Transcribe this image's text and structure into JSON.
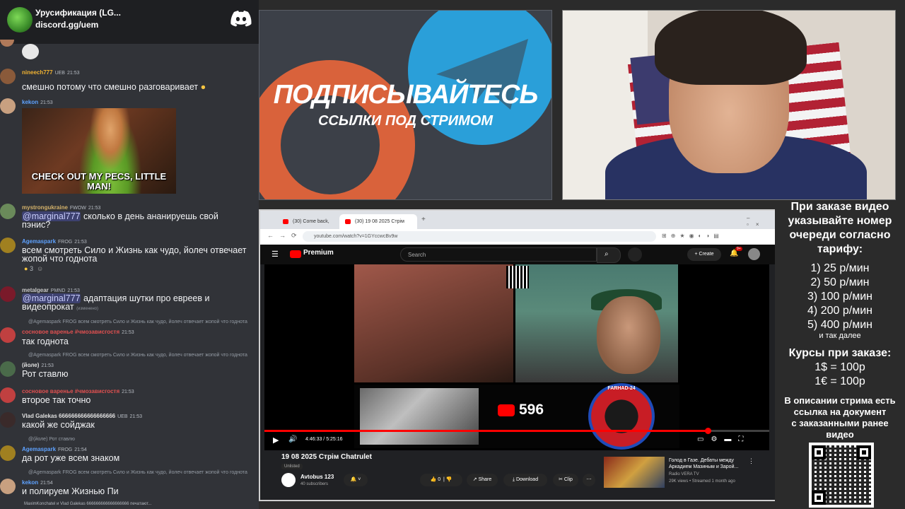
{
  "chat_header": {
    "server_name": "Урусификация (LG...",
    "invite": "discord.gg/uem"
  },
  "messages": [
    {
      "user": "nineech777",
      "badges": "UEB",
      "time": "21:53",
      "text": "смешно потому что смешно разговаривает",
      "user_color": "#f0b232"
    },
    {
      "user": "kekon",
      "time": "21:53",
      "gif_caption": "CHECK OUT MY PECS, LITTLE MAN!",
      "user_color": "#5ea2ff"
    },
    {
      "user": "mystrongukraine",
      "badges": "FWOW",
      "time": "21:53",
      "mention": "@marginal777",
      "text_a": " сколько в день ананируешь свой",
      "text_b": "пэнис?",
      "user_color": "#d4b26a"
    },
    {
      "user": "Agemaspark",
      "badges": "FROG",
      "time": "21:53",
      "text_a": "всем смотреть Сило и Жизнь как чудо, йолеч отвечает",
      "text_b": "жопой что годнота",
      "reaction": "3",
      "user_color": "#5ea2ff"
    },
    {
      "user": "metalgear",
      "badges": "PMND",
      "time": "21:53",
      "mention": "@marginal777",
      "text_a": " адаптация шутки про евреев и",
      "text_b": "видеопрокат",
      "edited": "(изменено)",
      "user_color": "#c8c8c8"
    },
    {
      "reply": "@Agemaspark FROG всем смотреть Сило и Жизнь как чудо, йолеч отвечает жопой что годнота",
      "user": "сосновое варенье #чмозависгостя",
      "time": "21:53",
      "text": "так годнота",
      "user_color": "#e05050"
    },
    {
      "reply": "@Agemaspark FROG всем смотреть Сило и Жизнь как чудо, йолеч отвечает жопой что годнота",
      "user": "(йоле)",
      "time": "21:53",
      "text": "Рот ставлю",
      "user_color": "#e0e0e0"
    },
    {
      "user": "сосновое варенье #чмозависгостя",
      "time": "21:53",
      "text": "второе так точно",
      "user_color": "#e05050"
    },
    {
      "user": "Vlad Galekas 666666666666666666",
      "badges": "UEB",
      "time": "21:53",
      "text": "какой же сойджак",
      "user_color": "#e0e0e0"
    },
    {
      "reply": "@(йоле) Рот ставлю",
      "user": "Agemaspark",
      "badges": "FROG",
      "time": "21:54",
      "text": "да рот уже всем знаком",
      "user_color": "#5ea2ff"
    },
    {
      "reply": "@Agemaspark FROG всем смотреть Сило и Жизнь как чудо, йолеч отвечает жопой что годнота",
      "user": "kekon",
      "time": "21:54",
      "text": "и полируем Жизнью Пи",
      "user_color": "#5ea2ff"
    }
  ],
  "typing": "MaximKonchatel и Vlad Galekas 666666666666666666 печатают...",
  "promo": {
    "title": "ПОДПИСЫВАЙТЕСЬ",
    "subtitle": "ССЫЛКИ ПОД СТРИМОМ"
  },
  "browser": {
    "tab1": "(30) Come back, kam...",
    "tab2": "(30) 19 08 2025 Стрім Chat...",
    "url": "youtube.com/watch?v=1GYccwcBv9w",
    "yt_logo": "Premium",
    "search_placeholder": "Search",
    "create": "+ Create",
    "notif_count": "9+",
    "video_overlay_count": "596",
    "badge_text": "FARHAD-24",
    "time": "4:46:33 / 5:25:16",
    "video_title": "19 08 2025 Стрім Chatrulet",
    "unlisted": "Unlisted",
    "channel": "Avtobus 123",
    "subscribers": "40 subscribers",
    "likes": "0",
    "share": "Share",
    "download": "Download",
    "clip": "Clip",
    "rec_title": "Голод в Газе. Дебаты между Аркадием Мазиным и Зарой...",
    "rec_channel": "Radio VERA TV",
    "rec_meta": "29K views • Streamed 1 month ago"
  },
  "info": {
    "l1": "При заказе видео",
    "l2": "указывайте номер",
    "l3": "очереди согласно",
    "l4": "тарифу:",
    "t1": "1) 25 р/мин",
    "t2": "2) 50 р/мин",
    "t3": "3) 100 р/мин",
    "t4": "4) 200 р/мин",
    "t5": "5) 400 р/мин",
    "more": "и так далее",
    "c1": "Курсы при заказе:",
    "c2": "1$ = 100р",
    "c3": "1€ = 100р",
    "d1": "В описании стрима есть",
    "d2": "ссылка на документ",
    "d3": "с заказанными ранее",
    "d4": "видео"
  }
}
